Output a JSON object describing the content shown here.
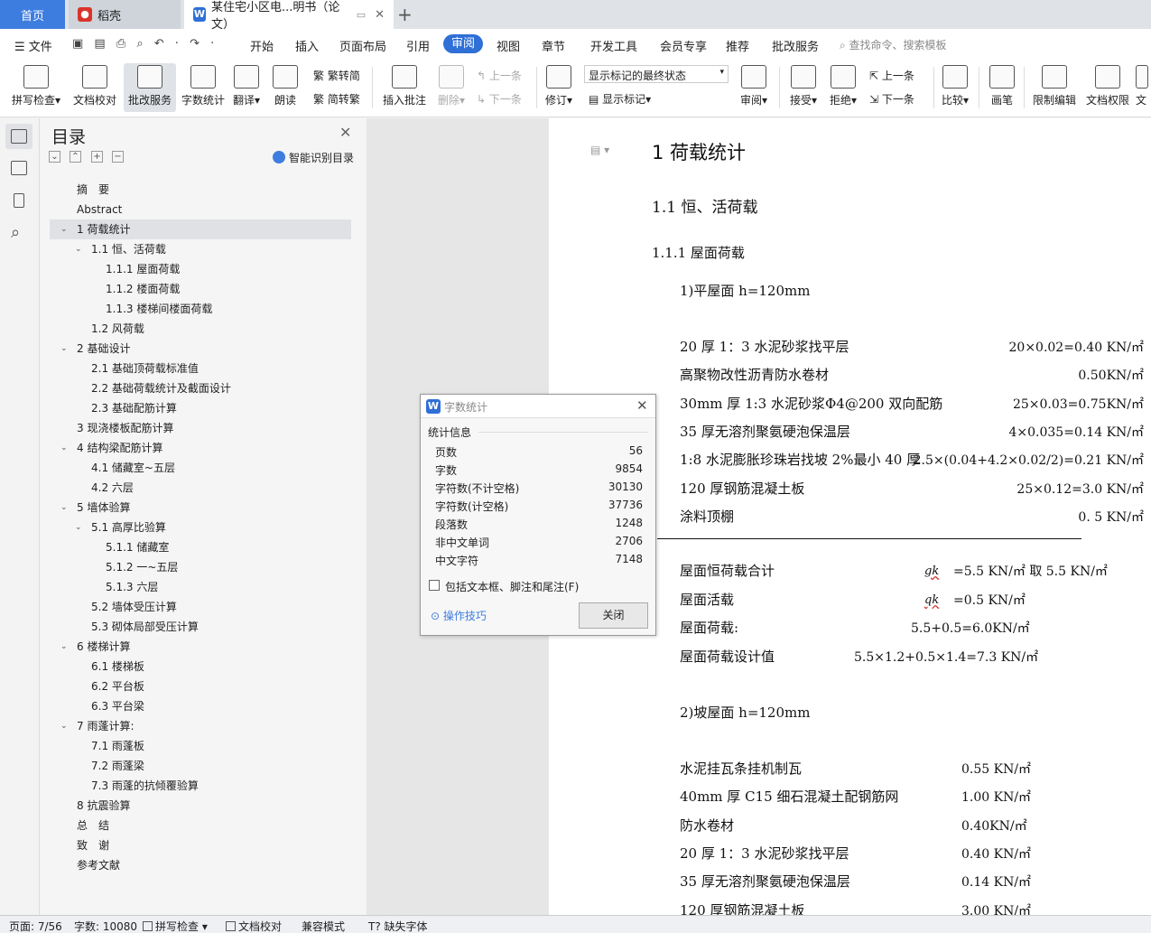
{
  "tabs": {
    "home": "首页",
    "daoke": "稻壳",
    "doc": "某住宅小区电...明书（论文）"
  },
  "menu": {
    "file": "文件",
    "items": [
      "开始",
      "插入",
      "页面布局",
      "引用",
      "审阅",
      "视图",
      "章节",
      "开发工具",
      "会员专享",
      "推荐",
      "批改服务"
    ],
    "active": "审阅",
    "search_placeholder": "查找命令、搜索模板"
  },
  "ribbon": {
    "spell": "拼写检查",
    "proof": "文档校对",
    "grade": "批改服务",
    "wordcount": "字数统计",
    "translate": "翻译",
    "read": "朗读",
    "to_trad": "繁转简",
    "to_simp": "简转繁",
    "insert_comment": "插入批注",
    "delete": "删除",
    "prev_comment": "上一条",
    "next_comment": "下一条",
    "track": "修订",
    "mark_state": "显示标记的最终状态",
    "show_marks": "显示标记",
    "review": "审阅",
    "accept": "接受",
    "reject": "拒绝",
    "prev": "上一条",
    "next": "下一条",
    "compare": "比较",
    "pen": "画笔",
    "restrict": "限制编辑",
    "doc_perm": "文档权限",
    "more": "文"
  },
  "toc": {
    "title": "目录",
    "smart": "智能识别目录",
    "items": [
      {
        "text": "摘　要",
        "level": 0
      },
      {
        "text": "Abstract",
        "level": 0
      },
      {
        "text": "1  荷载统计",
        "level": 0
      },
      {
        "text": "1.1  恒、活荷载",
        "level": 1
      },
      {
        "text": "1.1.1  屋面荷载",
        "level": 2
      },
      {
        "text": "1.1.2  楼面荷载",
        "level": 2
      },
      {
        "text": "1.1.3  楼梯间楼面荷载",
        "level": 2
      },
      {
        "text": "1.2  风荷载",
        "level": 1
      },
      {
        "text": "2  基础设计",
        "level": 0
      },
      {
        "text": "2.1  基础顶荷载标准值",
        "level": 1
      },
      {
        "text": "2.2  基础荷载统计及截面设计",
        "level": 1
      },
      {
        "text": "2.3  基础配筋计算",
        "level": 1
      },
      {
        "text": "3  现浇楼板配筋计算",
        "level": 0
      },
      {
        "text": "4  结构梁配筋计算",
        "level": 0
      },
      {
        "text": "4.1  储藏室~五层",
        "level": 1
      },
      {
        "text": "4.2  六层",
        "level": 1
      },
      {
        "text": "5  墙体验算",
        "level": 0
      },
      {
        "text": "5.1  高厚比验算",
        "level": 1
      },
      {
        "text": "5.1.1  储藏室",
        "level": 2
      },
      {
        "text": "5.1.2  一~五层",
        "level": 2
      },
      {
        "text": "5.1.3  六层",
        "level": 2
      },
      {
        "text": "5.2  墙体受压计算",
        "level": 1
      },
      {
        "text": "5.3  砌体局部受压计算",
        "level": 1
      },
      {
        "text": "6  楼梯计算",
        "level": 0
      },
      {
        "text": "6.1  楼梯板",
        "level": 1
      },
      {
        "text": "6.2  平台板",
        "level": 1
      },
      {
        "text": "6.3  平台梁",
        "level": 1
      },
      {
        "text": "7  雨蓬计算:",
        "level": 0
      },
      {
        "text": "7.1  雨蓬板",
        "level": 1
      },
      {
        "text": "7.2  雨蓬梁",
        "level": 1
      },
      {
        "text": "7.3  雨蓬的抗倾覆验算",
        "level": 1
      },
      {
        "text": "8  抗震验算",
        "level": 0
      },
      {
        "text": "总　结",
        "level": 0
      },
      {
        "text": "致　谢",
        "level": 0
      },
      {
        "text": "参考文献",
        "level": 0
      }
    ]
  },
  "doc": {
    "h1": "1  荷载统计",
    "h2": "1.1 恒、活荷载",
    "h3": "1.1.1 屋面荷载",
    "flat_roof": "1)平屋面  h=120mm",
    "flat_rows": [
      {
        "label": "20 厚 1：3 水泥砂浆找平层",
        "value": "20×0.02=0.40 KN/㎡"
      },
      {
        "label": "高聚物改性沥青防水卷材",
        "value": "0.50KN/㎡"
      },
      {
        "label": "30mm 厚 1:3 水泥砂浆Φ4@200 双向配筋",
        "value": "25×0.03=0.75KN/㎡"
      },
      {
        "label": "35 厚无溶剂聚氨硬泡保温层",
        "value": "4×0.035=0.14 KN/㎡"
      },
      {
        "label": "1:8 水泥膨胀珍珠岩找坡 2%最小 40 厚",
        "value": "2.5×(0.04+4.2×0.02/2)=0.21 KN/㎡"
      },
      {
        "label": "120 厚钢筋混凝土板",
        "value": "25×0.12=3.0 KN/㎡"
      },
      {
        "label": "涂料顶棚",
        "value": "0. 5 KN/㎡"
      }
    ],
    "sum_dead_label": "屋面恒荷载合计",
    "sum_dead_sym": "gk",
    "sum_dead_value": "=5.5 KN/㎡  取 5.5 KN/㎡",
    "live_label": "屋面活载",
    "live_sym": "qk",
    "live_value": "=0.5 KN/㎡",
    "load_label": "屋面荷载:",
    "load_value": "5.5+0.5=6.0KN/㎡",
    "design_label": "屋面荷载设计值",
    "design_value": "5.5×1.2+0.5×1.4=7.3 KN/㎡",
    "slope_roof": "2)坡屋面  h=120mm",
    "slope_rows": [
      {
        "label": "水泥挂瓦条挂机制瓦",
        "value": "0.55 KN/㎡"
      },
      {
        "label": "40mm 厚 C15 细石混凝土配钢筋网",
        "value": "1.00 KN/㎡"
      },
      {
        "label": "防水卷材",
        "value": "0.40KN/㎡"
      },
      {
        "label": "20 厚 1：3 水泥砂浆找平层",
        "value": "0.40 KN/㎡"
      },
      {
        "label": "35 厚无溶剂聚氨硬泡保温层",
        "value": "0.14 KN/㎡"
      },
      {
        "label": "120 厚钢筋混凝土板",
        "value": "3.00 KN/㎡"
      }
    ]
  },
  "dialog": {
    "title": "字数统计",
    "section": "统计信息",
    "rows": [
      {
        "label": "页数",
        "value": "56"
      },
      {
        "label": "字数",
        "value": "9854"
      },
      {
        "label": "字符数(不计空格)",
        "value": "30130"
      },
      {
        "label": "字符数(计空格)",
        "value": "37736"
      },
      {
        "label": "段落数",
        "value": "1248"
      },
      {
        "label": "非中文单词",
        "value": "2706"
      },
      {
        "label": "中文字符",
        "value": "7148"
      }
    ],
    "checkbox": "包括文本框、脚注和尾注(F)",
    "tips": "操作技巧",
    "close": "关闭"
  },
  "status": {
    "page": "页面: 7/56",
    "words": "字数: 10080",
    "spell": "拼写检查",
    "proof": "文档校对",
    "compat": "兼容模式",
    "missing_font": "缺失字体"
  },
  "colors": {
    "accent": "#2f6fd6",
    "tab_home": "#3d7de0"
  }
}
